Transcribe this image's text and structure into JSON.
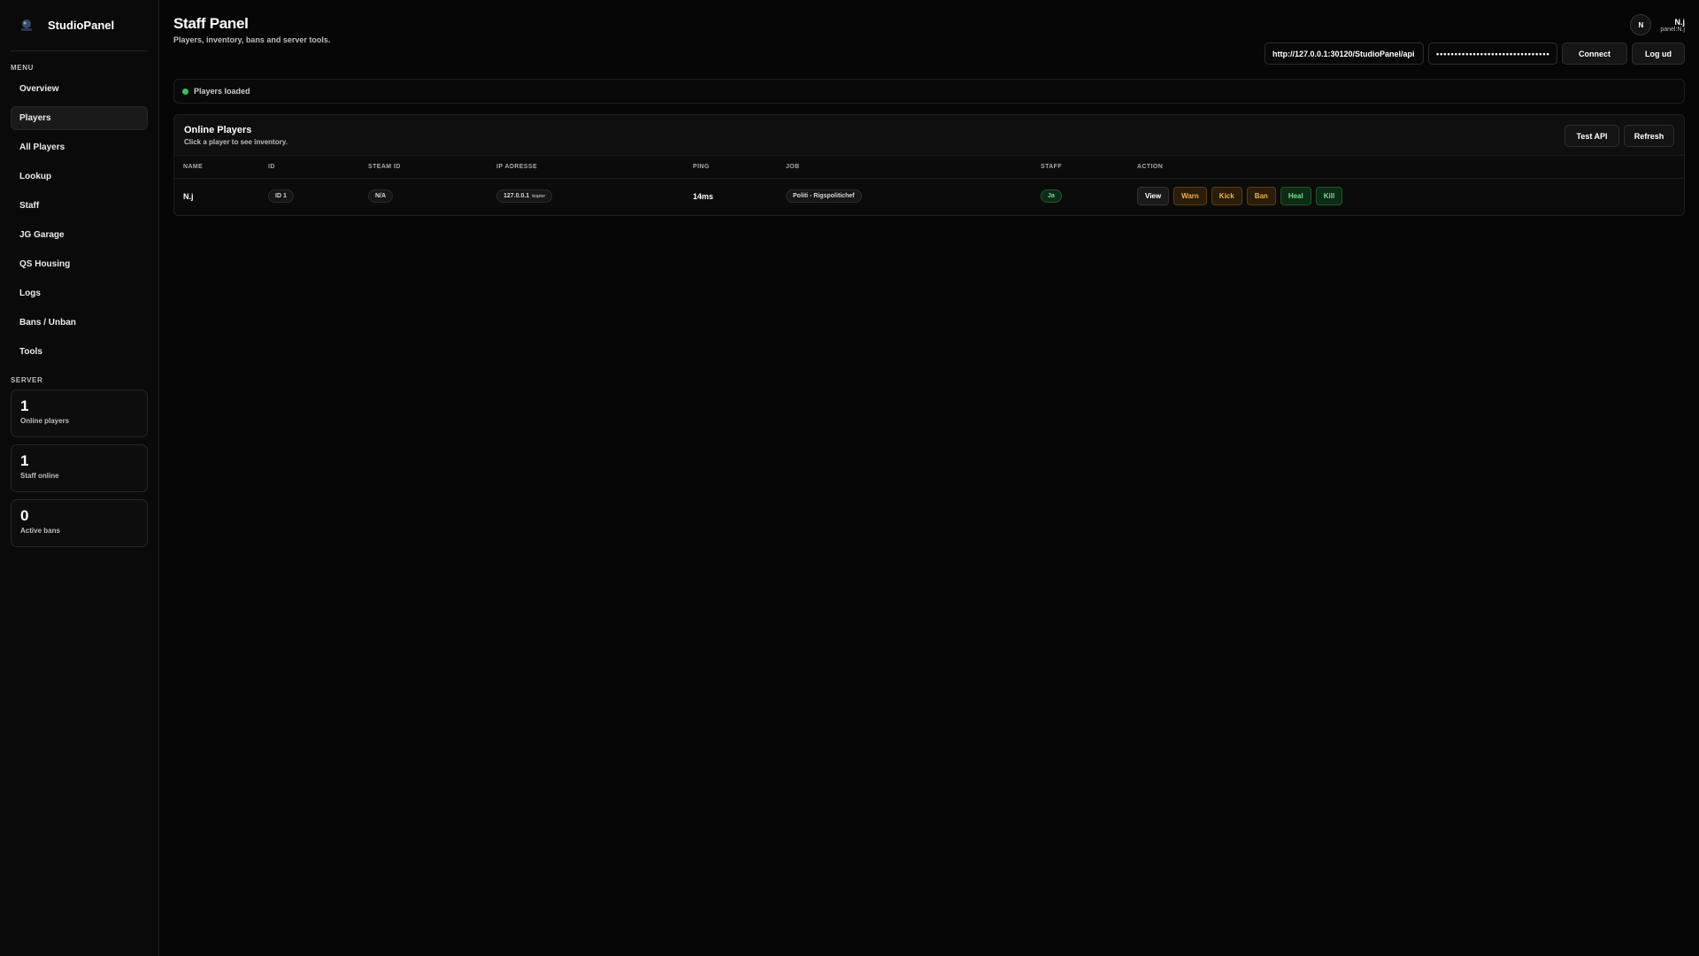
{
  "brand": {
    "name": "StudioPanel"
  },
  "sidebar": {
    "menu_label": "MENU",
    "items": [
      {
        "label": "Overview",
        "active": false
      },
      {
        "label": "Players",
        "active": true
      },
      {
        "label": "All Players",
        "active": false
      },
      {
        "label": "Lookup",
        "active": false
      },
      {
        "label": "Staff",
        "active": false
      },
      {
        "label": "JG Garage",
        "active": false
      },
      {
        "label": "QS Housing",
        "active": false
      },
      {
        "label": "Logs",
        "active": false
      },
      {
        "label": "Bans / Unban",
        "active": false
      },
      {
        "label": "Tools",
        "active": false
      }
    ],
    "server_label": "SERVER",
    "stats": [
      {
        "value": "1",
        "label": "Online players"
      },
      {
        "value": "1",
        "label": "Staff online"
      },
      {
        "value": "0",
        "label": "Active bans"
      }
    ]
  },
  "header": {
    "title": "Staff Panel",
    "subtitle": "Players, inventory, bans and server tools."
  },
  "user": {
    "initial": "N",
    "name": "N.j",
    "handle": "panel:N.j"
  },
  "toolbar": {
    "api_url": "http://127.0.0.1:30120/StudioPanel/api",
    "password": "••••••••••••••••••••••••••••••••••••••••",
    "connect_label": "Connect",
    "logout_label": "Log ud"
  },
  "status": {
    "text": "Players loaded",
    "color": "#3bbf5a"
  },
  "online_players": {
    "title": "Online Players",
    "subtitle": "Click a player to see inventory.",
    "test_api_label": "Test API",
    "refresh_label": "Refresh",
    "columns": [
      "NAME",
      "ID",
      "STEAM ID",
      "IP ADRESSE",
      "PING",
      "JOB",
      "STAFF",
      "ACTION"
    ],
    "rows": [
      {
        "name": "N.j",
        "id": "ID 1",
        "steam_id": "N/A",
        "ip": "127.0.0.1",
        "ip_sub": "kopier",
        "ping": "14ms",
        "job": "Politi - Rigspolitichef",
        "staff": "Ja",
        "actions": [
          "View",
          "Warn",
          "Kick",
          "Ban",
          "Heal",
          "Kill"
        ]
      }
    ]
  },
  "colors": {
    "warn": "#f0b24a",
    "heal": "#6fe08a"
  }
}
